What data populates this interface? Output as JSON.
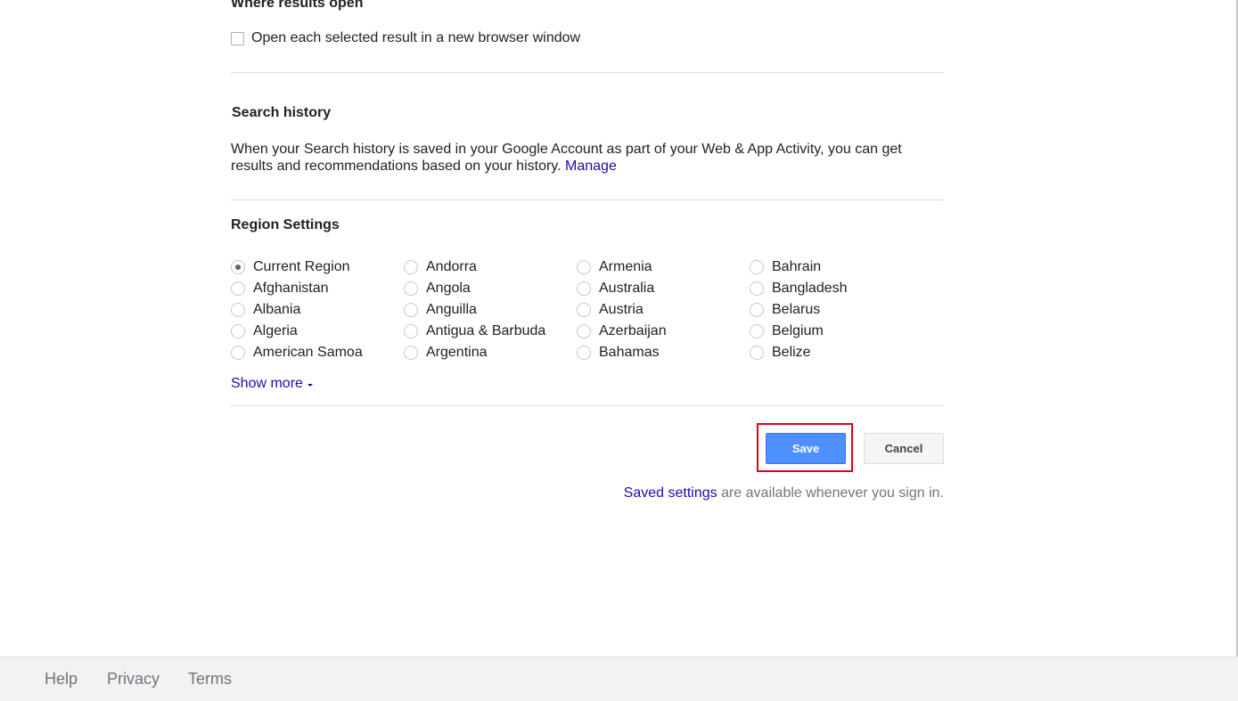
{
  "results_section": {
    "title": "Where results open",
    "checkbox_label": "Open each selected result in a new browser window",
    "checked": false
  },
  "history_section": {
    "title": "Search history",
    "text": "When your Search history is saved in your Google Account as part of your Web & App Activity, you can get results and recommendations based on your history.",
    "manage_link": "Manage"
  },
  "region_section": {
    "title": "Region Settings",
    "selected": "Current Region",
    "regions": [
      "Current Region",
      "Afghanistan",
      "Albania",
      "Algeria",
      "American Samoa",
      "Andorra",
      "Angola",
      "Anguilla",
      "Antigua & Barbuda",
      "Argentina",
      "Armenia",
      "Australia",
      "Austria",
      "Azerbaijan",
      "Bahamas",
      "Bahrain",
      "Bangladesh",
      "Belarus",
      "Belgium",
      "Belize"
    ],
    "show_more": "Show more"
  },
  "actions": {
    "save_label": "Save",
    "cancel_label": "Cancel",
    "saved_settings_link": "Saved settings",
    "saved_settings_text": " are available whenever you sign in."
  },
  "footer": {
    "help": "Help",
    "privacy": "Privacy",
    "terms": "Terms"
  },
  "colors": {
    "link": "#1a0dab",
    "save_button": "#4d90fe",
    "highlight": "#e0001b"
  }
}
